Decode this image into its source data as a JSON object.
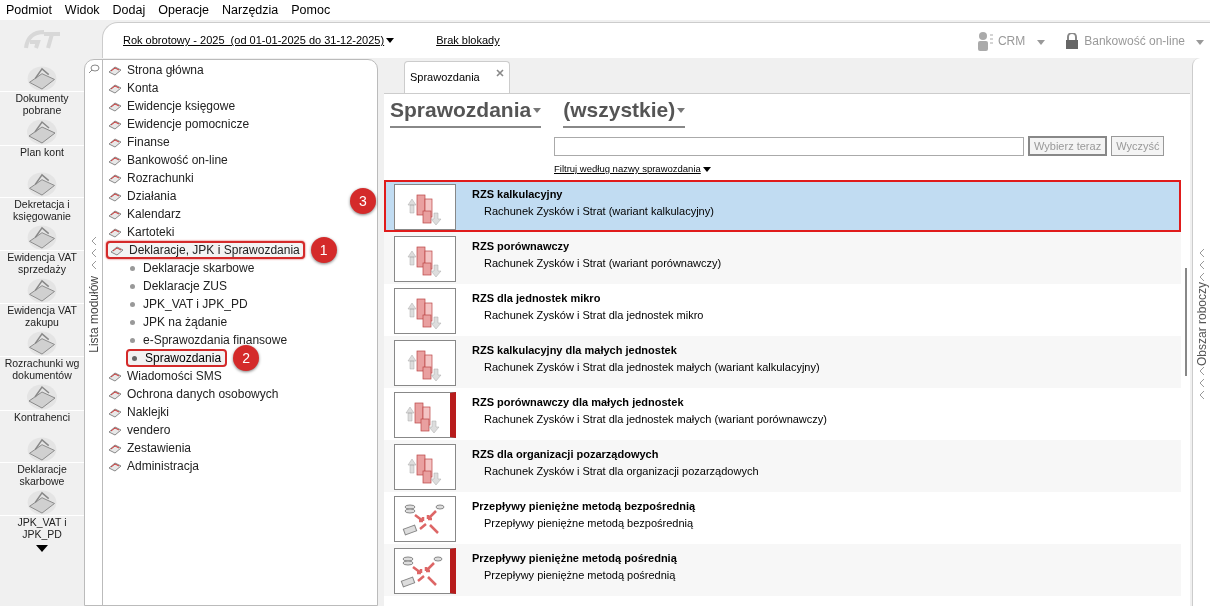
{
  "menu": [
    "Podmiot",
    "Widok",
    "Dodaj",
    "Operacje",
    "Narzędzia",
    "Pomoc"
  ],
  "launcher": {
    "items": [
      {
        "label": "Dokumenty pobrane"
      },
      {
        "label": "Plan kont"
      },
      {
        "label": "Dekretacja i księgowanie"
      },
      {
        "label": "Ewidencja VAT sprzedaży"
      },
      {
        "label": "Ewidencja VAT zakupu"
      },
      {
        "label": "Rozrachunki wg dokumentów"
      },
      {
        "label": "Kontrahenci"
      },
      {
        "label": "Deklaracje skarbowe"
      },
      {
        "label": "JPK_VAT i JPK_PD"
      }
    ]
  },
  "top_bar": {
    "fiscal_year": "Rok obrotowy - 2025  (od 01-01-2025 do 31-12-2025)",
    "lock_status": "Brak blokady",
    "crm": "CRM",
    "banking": "Bankowość on-line"
  },
  "module_list": {
    "title": "Lista modułów",
    "items": [
      {
        "label": "Strona główna"
      },
      {
        "label": "Konta"
      },
      {
        "label": "Ewidencje księgowe"
      },
      {
        "label": "Ewidencje pomocnicze"
      },
      {
        "label": "Finanse"
      },
      {
        "label": "Bankowość on-line"
      },
      {
        "label": "Rozrachunki"
      },
      {
        "label": "Działania"
      },
      {
        "label": "Kalendarz"
      },
      {
        "label": "Kartoteki"
      },
      {
        "label": "Deklaracje, JPK i Sprawozdania",
        "callout": "1",
        "expanded": true,
        "children": [
          {
            "label": "Deklaracje skarbowe",
            "selected": false
          },
          {
            "label": "Deklaracje ZUS",
            "selected": false
          },
          {
            "label": "JPK_VAT i JPK_PD",
            "selected": false
          },
          {
            "label": "JPK na żądanie",
            "selected": false
          },
          {
            "label": "e-Sprawozdania finansowe",
            "selected": false
          },
          {
            "label": "Sprawozdania",
            "selected": true,
            "callout": "2"
          }
        ]
      },
      {
        "label": "Wiadomości SMS"
      },
      {
        "label": "Ochrona danych osobowych"
      },
      {
        "label": "Naklejki"
      },
      {
        "label": "vendero"
      },
      {
        "label": "Zestawienia"
      },
      {
        "label": "Administracja"
      }
    ]
  },
  "tab": {
    "label": "Sprawozdania"
  },
  "header": {
    "title": "Sprawozdania",
    "filter": "(wszystkie)"
  },
  "search": {
    "button_select": "Wybierz teraz",
    "button_clear": "Wyczyść",
    "filter_link": "Filtruj według nazwy sprawozdania"
  },
  "reports": [
    {
      "kind": "chart",
      "title": "RZS kalkulacyjny",
      "description": "Rachunek Zysków i Strat (wariant kalkulacyjny)",
      "selected": true,
      "flagged": false,
      "callout": "3"
    },
    {
      "kind": "chart",
      "title": "RZS porównawczy",
      "description": "Rachunek Zysków i Strat (wariant porównawczy)",
      "selected": false,
      "flagged": false
    },
    {
      "kind": "chart",
      "title": "RZS dla jednostek mikro",
      "description": "Rachunek Zysków i Strat dla jednostek mikro",
      "selected": false,
      "flagged": false
    },
    {
      "kind": "chart",
      "title": "RZS kalkulacyjny dla małych jednostek",
      "description": "Rachunek Zysków i Strat dla jednostek małych (wariant kalkulacyjny)",
      "selected": false,
      "flagged": false
    },
    {
      "kind": "chart",
      "title": "RZS porównawczy dla małych jednostek",
      "description": "Rachunek Zysków i Strat dla jednostek małych (wariant porównawczy)",
      "selected": false,
      "flagged": true
    },
    {
      "kind": "chart",
      "title": "RZS dla organizacji pozarządowych",
      "description": "Rachunek Zysków i Strat dla organizacji pozarządowych",
      "selected": false,
      "flagged": false
    },
    {
      "kind": "flow",
      "title": "Przepływy pieniężne metodą bezpośrednią",
      "description": "Przepływy pieniężne metodą bezpośrednią",
      "selected": false,
      "flagged": false
    },
    {
      "kind": "flow",
      "title": "Przepływy pieniężne metodą pośrednią",
      "description": "Przepływy pieniężne metodą pośrednią",
      "selected": false,
      "flagged": true
    }
  ],
  "workspace": {
    "title": "Obszar roboczy"
  }
}
